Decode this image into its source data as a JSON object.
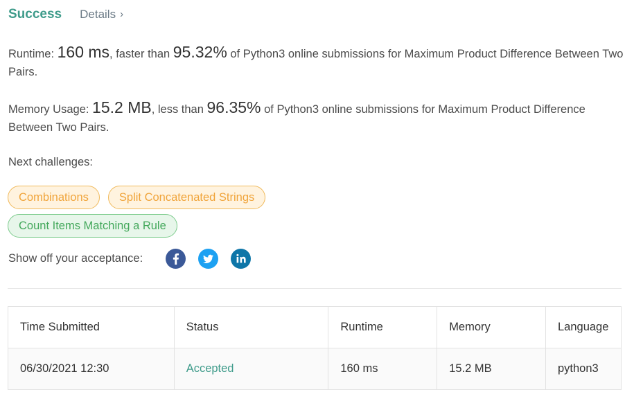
{
  "header": {
    "status": "Success",
    "details_label": "Details",
    "details_chevron": "›"
  },
  "runtime_stat": {
    "label": "Runtime: ",
    "value": "160 ms",
    "comparison": ", faster than ",
    "percent": "95.32%",
    "suffix": " of Python3 online submissions for Maximum Product Difference Between Two Pairs."
  },
  "memory_stat": {
    "label": "Memory Usage: ",
    "value": "15.2 MB",
    "comparison": ", less than ",
    "percent": "96.35%",
    "suffix": " of Python3 online submissions for Maximum Product Difference Between Two Pairs."
  },
  "next_challenges": {
    "label": "Next challenges:",
    "items": [
      {
        "label": "Combinations",
        "difficulty": "medium"
      },
      {
        "label": "Split Concatenated Strings",
        "difficulty": "medium"
      },
      {
        "label": "Count Items Matching a Rule",
        "difficulty": "easy"
      }
    ]
  },
  "share": {
    "label": "Show off your acceptance:",
    "icons": [
      {
        "name": "facebook-icon",
        "glyph": "f",
        "color": "#3b5998"
      },
      {
        "name": "twitter-icon",
        "glyph": "twitter",
        "color": "#1da1f2"
      },
      {
        "name": "linkedin-icon",
        "glyph": "in",
        "color": "#0e76a8"
      }
    ]
  },
  "table": {
    "headers": [
      "Time Submitted",
      "Status",
      "Runtime",
      "Memory",
      "Language"
    ],
    "rows": [
      [
        "06/30/2021 12:30",
        "Accepted",
        "160 ms",
        "15.2 MB",
        "python3"
      ]
    ]
  },
  "colors": {
    "success": "#3e9b8a",
    "medium_tag_bg": "#fff3df",
    "medium_tag_text": "#f0a43a",
    "easy_tag_bg": "#e7f6ea",
    "easy_tag_text": "#43a85b"
  }
}
